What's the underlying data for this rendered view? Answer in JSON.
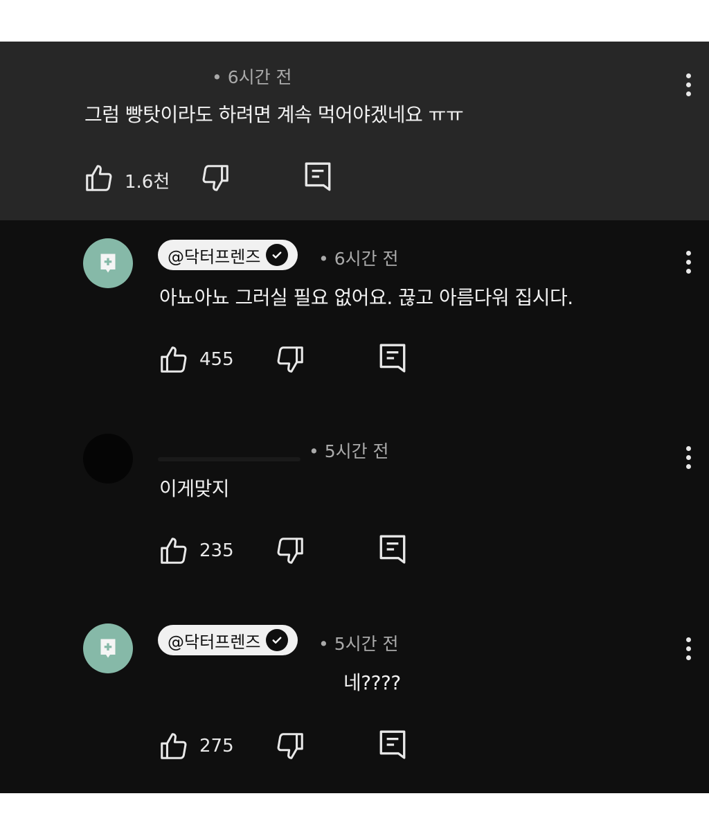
{
  "comments": [
    {
      "author": "",
      "time": "• 6시간 전",
      "text": "그럼 빵탓이라도 하려면 계속 먹어야겠네요 ㅠㅠ",
      "likes": "1.6천",
      "highlighted": true
    },
    {
      "author": "@닥터프렌즈",
      "verified": true,
      "time": "• 6시간 전",
      "text": "아뇨아뇨 그러실 필요 없어요. 끊고 아름다워 집시다.",
      "likes": "455"
    },
    {
      "author": "",
      "time": "• 5시간 전",
      "text": "이게맞지",
      "likes": "235"
    },
    {
      "author": "@닥터프렌즈",
      "verified": true,
      "time": "• 5시간 전",
      "text": "네????",
      "likes": "275"
    }
  ],
  "colors": {
    "background": "#0f0f0f",
    "highlight": "#272727",
    "avatar_channel": "#86b9a8",
    "text": "#f1f1f1",
    "meta": "#aaaaaa"
  },
  "icons": [
    "like-icon",
    "dislike-icon",
    "reply-icon",
    "more-vert-icon",
    "verified-check-icon",
    "channel-avatar-icon"
  ]
}
